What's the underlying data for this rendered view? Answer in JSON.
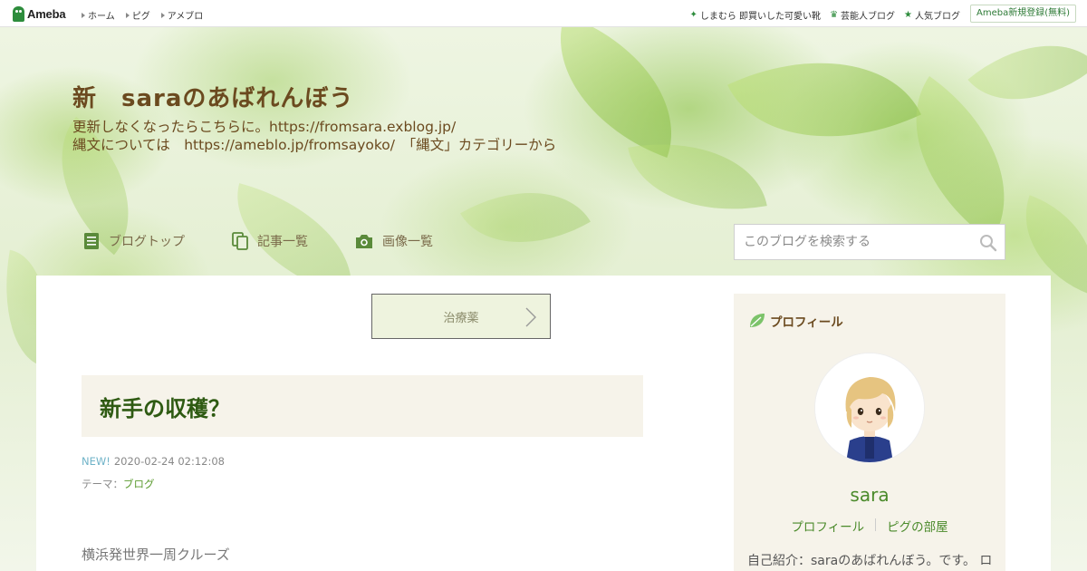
{
  "topbar": {
    "logo_text": "Ameba",
    "nav": [
      "ホーム",
      "ピグ",
      "アメブロ"
    ],
    "right_links": [
      "しまむら 即買いした可愛い靴",
      "芸能人ブログ",
      "人気ブログ"
    ],
    "signup": "Ameba新規登録(無料)"
  },
  "blog": {
    "title": "新　saraのあばれんぼう",
    "desc_line1": "更新しなくなったらこちらに。https://fromsara.exblog.jp/",
    "desc_line2": "縄文については　https://ameblo.jp/fromsayoko/　「縄文」カテゴリーから"
  },
  "gnav": {
    "top": "ブログトップ",
    "entries": "記事一覧",
    "images": "画像一覧"
  },
  "search": {
    "placeholder": "このブログを検索する"
  },
  "entry": {
    "theme_button": "治療薬",
    "title": "新手の収穫？",
    "new_label": "NEW!",
    "datetime": "2020-02-24 02:12:08",
    "theme_prefix": "テーマ：",
    "theme_name": "ブログ",
    "body_line1": "横浜発世界一周クルーズ"
  },
  "profile": {
    "heading": "プロフィール",
    "username": "sara",
    "link_profile": "プロフィール",
    "link_room": "ピグの部屋",
    "intro": "自己紹介：saraのあばれんぼう。です。 ロ"
  },
  "colors": {
    "brand_green": "#2d8c3c",
    "title_brown": "#6b4a1f",
    "entry_title_green": "#2e5a12",
    "link_green": "#4a8a2a"
  }
}
